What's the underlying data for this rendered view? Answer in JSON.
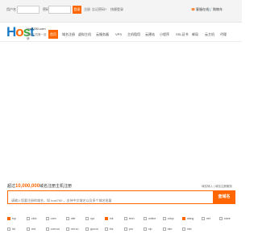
{
  "topbar": {
    "username_label": "用户名",
    "password_label": "密码",
    "login_button": "登录",
    "register_link": "注册",
    "forgot_link": "忘记密码?",
    "quick_login_link": "快捷登录",
    "service_label": "客服在线",
    "cart_label": "购物车"
  },
  "logo": {
    "brand": "Host",
    "brand_tail": "76",
    "site": "Host760.com",
    "slogan": "建站主机第一品牌"
  },
  "nav": [
    {
      "label": "首页"
    },
    {
      "label": "域名注册"
    },
    {
      "label": "虚拟主机"
    },
    {
      "label": "云服务器"
    },
    {
      "label": "VPS"
    },
    {
      "label": "主机租用"
    },
    {
      "label": "云建站"
    },
    {
      "label": "小程序"
    },
    {
      "label": "SSL证书"
    },
    {
      "label": "邮局"
    },
    {
      "label": "云主机"
    },
    {
      "label": "代理"
    }
  ],
  "domain_search": {
    "title_prefix": "超过",
    "count": "10,000,000",
    "title_suffix": "域名注册主机注册",
    "links": "域名转入 | 域名注册服务",
    "placeholder": "请输入您要注册的域名，如 host760 ，支持中文域名以及多个域名批量",
    "button": "查域名"
  },
  "tlds": [
    {
      "name": ".top",
      "checked": true
    },
    {
      "name": ".club",
      "checked": false
    },
    {
      "name": ".com",
      "checked": false
    },
    {
      "name": ".site",
      "checked": false
    },
    {
      "name": ".xyz",
      "checked": false
    },
    {
      "name": ".ink",
      "checked": true
    },
    {
      "name": ".tech",
      "checked": false
    },
    {
      "name": ".online",
      "checked": false
    },
    {
      "name": ".shop",
      "checked": false
    },
    {
      "name": ".wang",
      "checked": true
    },
    {
      "name": ".net",
      "checked": false
    },
    {
      "name": ".store",
      "checked": false
    },
    {
      "name": ".ltd",
      "checked": false
    },
    {
      "name": ".red",
      "checked": false
    },
    {
      "name": ".com.cn",
      "checked": false
    },
    {
      "name": ".net.cn",
      "checked": false
    },
    {
      "name": ".gov.cn",
      "checked": false
    },
    {
      "name": ".biz",
      "checked": false
    },
    {
      "name": ".pro",
      "checked": false
    },
    {
      "name": ".vip",
      "checked": false
    },
    {
      "name": ".kim",
      "checked": false
    },
    {
      "name": ".info",
      "checked": false
    }
  ],
  "colors": {
    "accent": "#ff6600",
    "logo_blue": "#1a7cc9",
    "logo_green": "#3aa83a"
  }
}
